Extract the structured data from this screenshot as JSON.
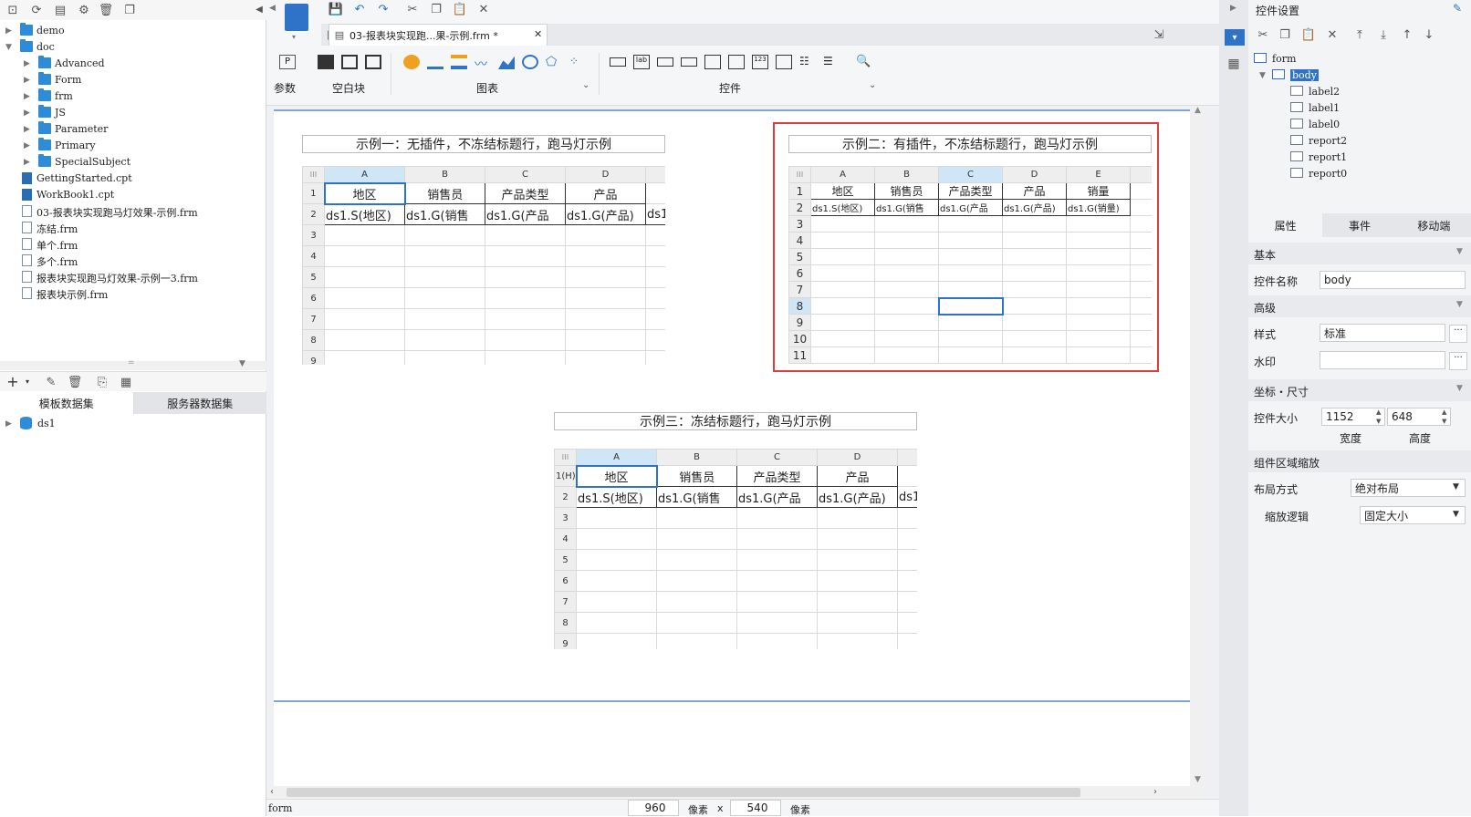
{
  "left_panel": {
    "tree": [
      {
        "label": "demo",
        "type": "folder",
        "level": 0,
        "expanded": false
      },
      {
        "label": "doc",
        "type": "folder",
        "level": 0,
        "expanded": true
      },
      {
        "label": "Advanced",
        "type": "folder",
        "level": 1,
        "expanded": false
      },
      {
        "label": "Form",
        "type": "folder",
        "level": 1,
        "expanded": false
      },
      {
        "label": "frm",
        "type": "folder",
        "level": 1,
        "expanded": false
      },
      {
        "label": "JS",
        "type": "folder",
        "level": 1,
        "expanded": false
      },
      {
        "label": "Parameter",
        "type": "folder",
        "level": 1,
        "expanded": false
      },
      {
        "label": "Primary",
        "type": "folder",
        "level": 1,
        "expanded": false
      },
      {
        "label": "SpecialSubject",
        "type": "folder",
        "level": 1,
        "expanded": false
      },
      {
        "label": "GettingStarted.cpt",
        "type": "cpt",
        "level": 0
      },
      {
        "label": "WorkBook1.cpt",
        "type": "cpt",
        "level": 0
      },
      {
        "label": "03-报表块实现跑马灯效果-示例.frm",
        "type": "frm",
        "level": 0
      },
      {
        "label": "冻结.frm",
        "type": "frm",
        "level": 0
      },
      {
        "label": "单个.frm",
        "type": "frm",
        "level": 0
      },
      {
        "label": "多个.frm",
        "type": "frm",
        "level": 0
      },
      {
        "label": "报表块实现跑马灯效果-示例一3.frm",
        "type": "frm",
        "level": 0
      },
      {
        "label": "报表块示例.frm",
        "type": "frm",
        "level": 0
      }
    ],
    "dataset_tabs": [
      "模板数据集",
      "服务器数据集"
    ],
    "datasets": [
      "ds1"
    ]
  },
  "center": {
    "doc_tab_title": "03-报表块实现跑...果-示例.frm *",
    "groups": {
      "param": "参数",
      "blank_block": "空白块",
      "chart": "图表",
      "widget": "控件"
    },
    "reports": [
      {
        "title": "示例一：无插件，不冻结标题行，跑马灯示例",
        "columns": [
          "A",
          "B",
          "C",
          "D"
        ],
        "row_numbers": [
          "1",
          "2",
          "3",
          "4",
          "5",
          "6",
          "7",
          "8",
          "9"
        ],
        "header_row": [
          "地区",
          "销售员",
          "产品类型",
          "产品"
        ],
        "data_row": [
          "ds1.S(地区)",
          "ds1.G(销售",
          "ds1.G(产品",
          "ds1.G(产品)",
          "ds1"
        ]
      },
      {
        "title": "示例二：有插件，不冻结标题行，跑马灯示例",
        "columns": [
          "A",
          "B",
          "C",
          "D",
          "E"
        ],
        "row_numbers": [
          "1",
          "2",
          "3",
          "4",
          "5",
          "6",
          "7",
          "8",
          "9",
          "10",
          "11"
        ],
        "header_row": [
          "地区",
          "销售员",
          "产品类型",
          "产品",
          "销量"
        ],
        "data_row": [
          "ds1.S(地区)",
          "ds1.G(销售",
          "ds1.G(产品",
          "ds1.G(产品)",
          "ds1.G(销量)"
        ]
      },
      {
        "title": "示例三：冻结标题行，跑马灯示例",
        "columns": [
          "A",
          "B",
          "C",
          "D"
        ],
        "row_numbers": [
          "1(H)",
          "2",
          "3",
          "4",
          "5",
          "6",
          "7",
          "8",
          "9"
        ],
        "header_row": [
          "地区",
          "销售员",
          "产品类型",
          "产品"
        ],
        "data_row": [
          "ds1.S(地区)",
          "ds1.G(销售",
          "ds1.G(产品",
          "ds1.G(产品)",
          "ds1"
        ]
      }
    ],
    "status": {
      "left": "form",
      "width": "960",
      "unit1": "像素",
      "times": "x",
      "height": "540",
      "unit2": "像素"
    }
  },
  "right_panel": {
    "title": "控件设置",
    "widget_tree": [
      "form",
      "body",
      "label2",
      "label1",
      "label0",
      "report2",
      "report1",
      "report0"
    ],
    "tabs": [
      "属性",
      "事件",
      "移动端"
    ],
    "sections": {
      "basic": "基本",
      "advanced": "高级",
      "coords": "坐标・尺寸",
      "scale": "组件区域缩放"
    },
    "fields": {
      "name_label": "控件名称",
      "name_value": "body",
      "style_label": "样式",
      "style_value": "标准",
      "watermark_label": "水印",
      "watermark_value": "",
      "size_label": "控件大小",
      "width_value": "1152",
      "height_value": "648",
      "width_caption": "宽度",
      "height_caption": "高度",
      "layout_label": "布局方式",
      "layout_value": "绝对布局",
      "zoom_label": "缩放逻辑",
      "zoom_value": "固定大小"
    },
    "colors": {
      "accent": "#2f73c8",
      "highlight": "#e03c3c"
    }
  }
}
